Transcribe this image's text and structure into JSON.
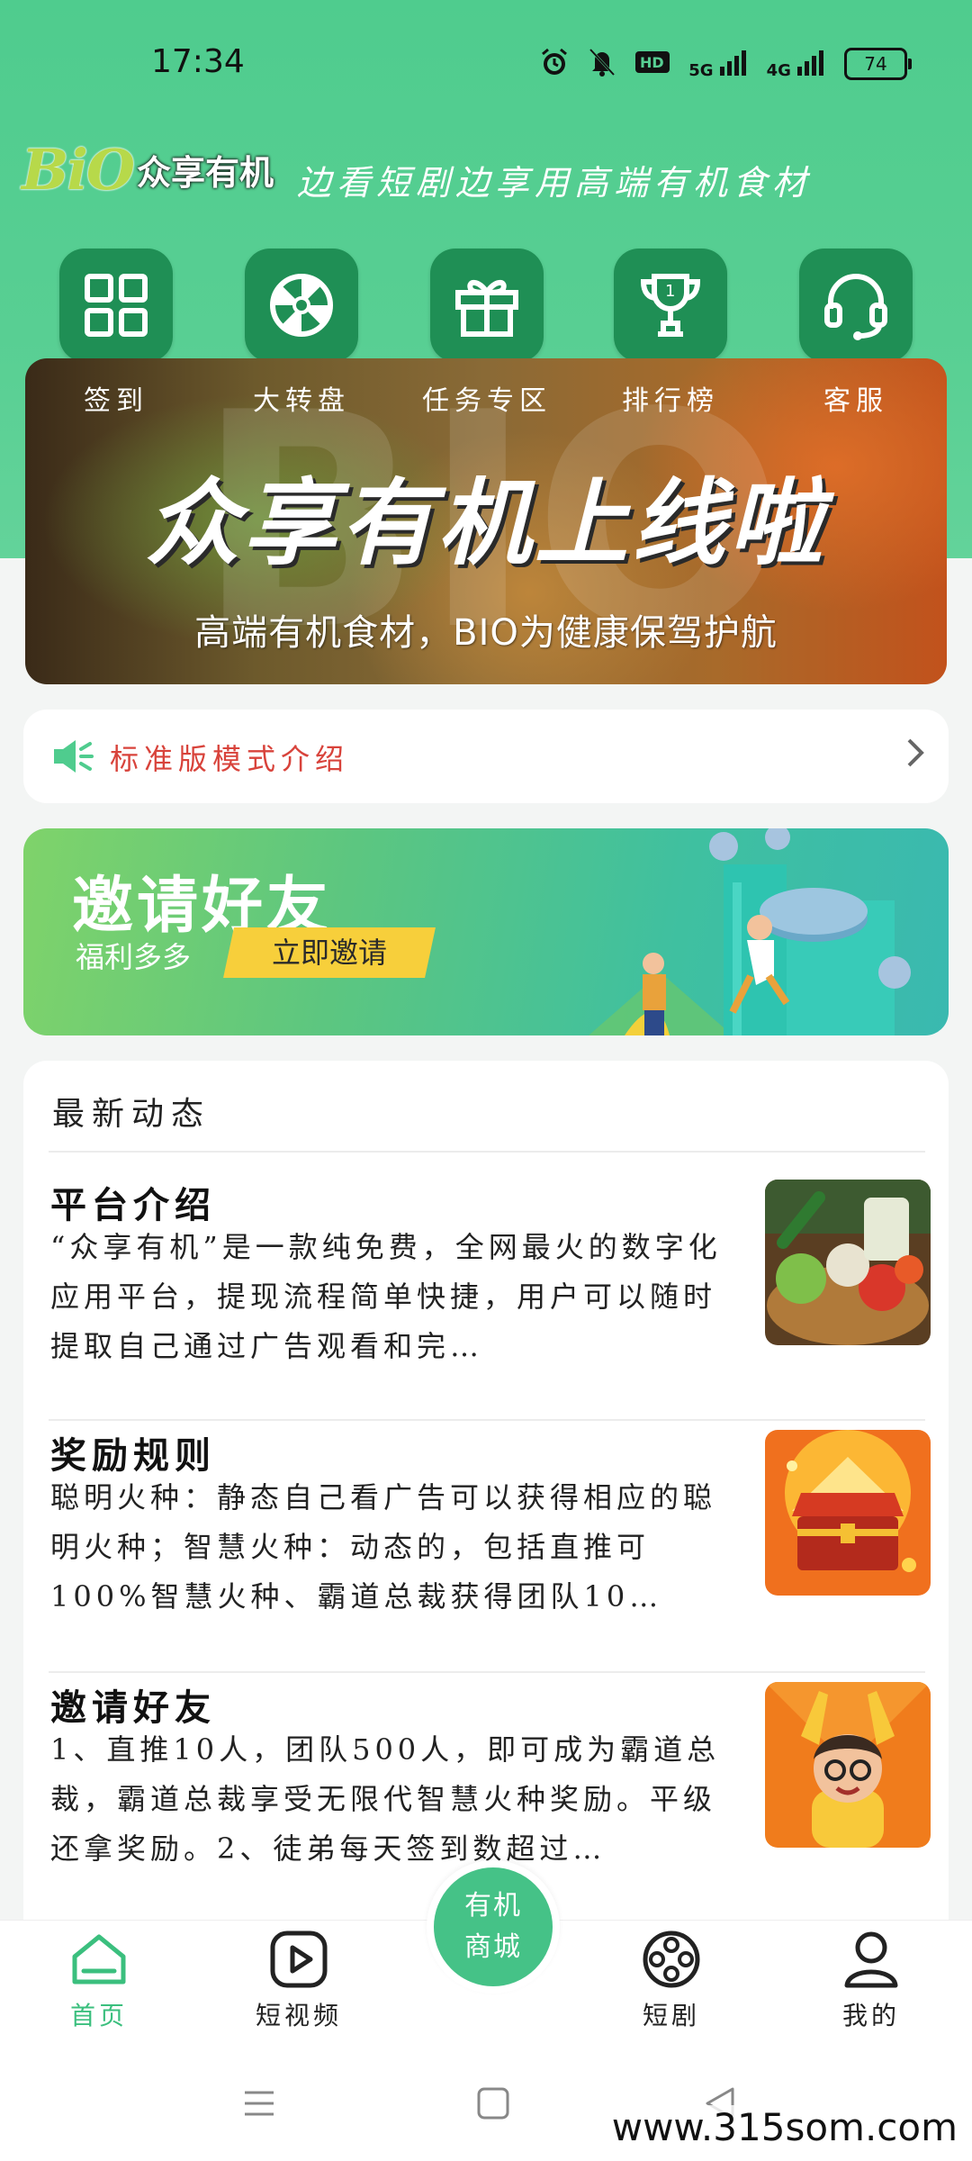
{
  "status_bar": {
    "time": "17:34",
    "battery": "74",
    "net1": "5G",
    "net2": "4G",
    "hd": "HD"
  },
  "header": {
    "logo_bio": "BiO",
    "logo_text": "众享有机",
    "slogan": "边看短剧边享用高端有机食材"
  },
  "quick_actions": [
    {
      "label": "签到",
      "icon": "grid-icon"
    },
    {
      "label": "大转盘",
      "icon": "wheel-icon"
    },
    {
      "label": "任务专区",
      "icon": "gift-icon"
    },
    {
      "label": "排行榜",
      "icon": "trophy-icon"
    },
    {
      "label": "客服",
      "icon": "headset-icon"
    }
  ],
  "banner": {
    "watermark": "BIO",
    "title": "众享有机上线啦",
    "subtitle": "高端有机食材，BIO为健康保驾护航"
  },
  "notice": {
    "text": "标准版模式介绍",
    "icon": "speaker-icon"
  },
  "invite_card": {
    "title": "邀请好友",
    "subtitle": "福利多多",
    "button": "立即邀请"
  },
  "news": {
    "title": "最新动态",
    "articles": [
      {
        "title": "平台介绍",
        "desc": "“众享有机”是一款纯免费，全网最火的数字化应用平台，提现流程简单快捷，用户可以随时提取自己通过广告观看和完…",
        "thumb": "vegetables-basket"
      },
      {
        "title": "奖励规则",
        "desc": "聪明火种：静态自己看广告可以获得相应的聪明火种；智慧火种：动态的，包括直推可100%智慧火种、霸道总裁获得团队10…",
        "thumb": "treasure-chest"
      },
      {
        "title": "邀请好友",
        "desc": "1、直推10人，团队500人，即可成为霸道总裁，霸道总裁享受无限代智慧火种奖励。平级还拿奖励。2、徒弟每天签到数超过…",
        "thumb": "cartoon-boy"
      }
    ]
  },
  "bottom_nav": {
    "tabs": [
      {
        "label": "首页",
        "icon": "home-icon"
      },
      {
        "label": "短视频",
        "icon": "play-icon"
      },
      {
        "label": "短剧",
        "icon": "film-reel-icon"
      },
      {
        "label": "我的",
        "icon": "user-icon"
      }
    ],
    "mall_line1": "有机",
    "mall_line2": "商城"
  },
  "watermark": "www.315som.com",
  "colors": {
    "primary": "#4fcc8e",
    "dark_green": "#1f8f55",
    "notice_red": "#d8433b",
    "accent_yellow": "#f7cf3b"
  }
}
